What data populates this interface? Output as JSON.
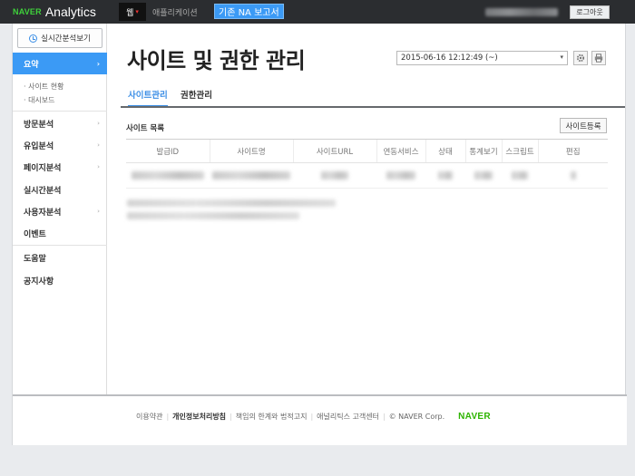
{
  "header": {
    "logo_brand": "NAVER",
    "logo_product": "Analytics",
    "nav_web": "웹",
    "nav_web_chevron": "▾",
    "nav_app": "애플리케이션",
    "nav_old_report": "기존 NA 보고서",
    "logout": "로그아웃"
  },
  "sidebar": {
    "realtime_button": "실시간분석보기",
    "summary": "요약",
    "summary_arrow": "›",
    "sub_items": [
      "· 사이트 현황",
      "· 대시보드"
    ],
    "items": [
      {
        "label": "방문분석",
        "chevron": "›"
      },
      {
        "label": "유입분석",
        "chevron": "›"
      },
      {
        "label": "페이지분석",
        "chevron": "›"
      },
      {
        "label": "실시간분석",
        "chevron": ""
      },
      {
        "label": "사용자분석",
        "chevron": "›"
      },
      {
        "label": "이벤트",
        "chevron": ""
      }
    ],
    "help": "도움말",
    "notice": "공지사항"
  },
  "main": {
    "title": "사이트 및 권한 관리",
    "datetime": "2015-06-16 12:12:49 (~)",
    "datetime_caret": "▾",
    "tabs": [
      "사이트관리",
      "권한관리"
    ],
    "section_title": "사이트 목록",
    "register_button": "사이트등록",
    "table_headers": [
      "발급ID",
      "사이트명",
      "사이트URL",
      "연동서비스",
      "상태",
      "통계보기",
      "스크립트",
      "편집"
    ]
  },
  "footer": {
    "links": [
      "이용약관",
      "개인정보처리방침",
      "책임의 한계와 법적고지",
      "애널리틱스 고객센터"
    ],
    "copyright": "© NAVER Corp.",
    "brand": "NAVER"
  },
  "colors": {
    "accent": "#3b9af5",
    "topbar": "#2b2d30",
    "naver_green": "#2db400"
  }
}
